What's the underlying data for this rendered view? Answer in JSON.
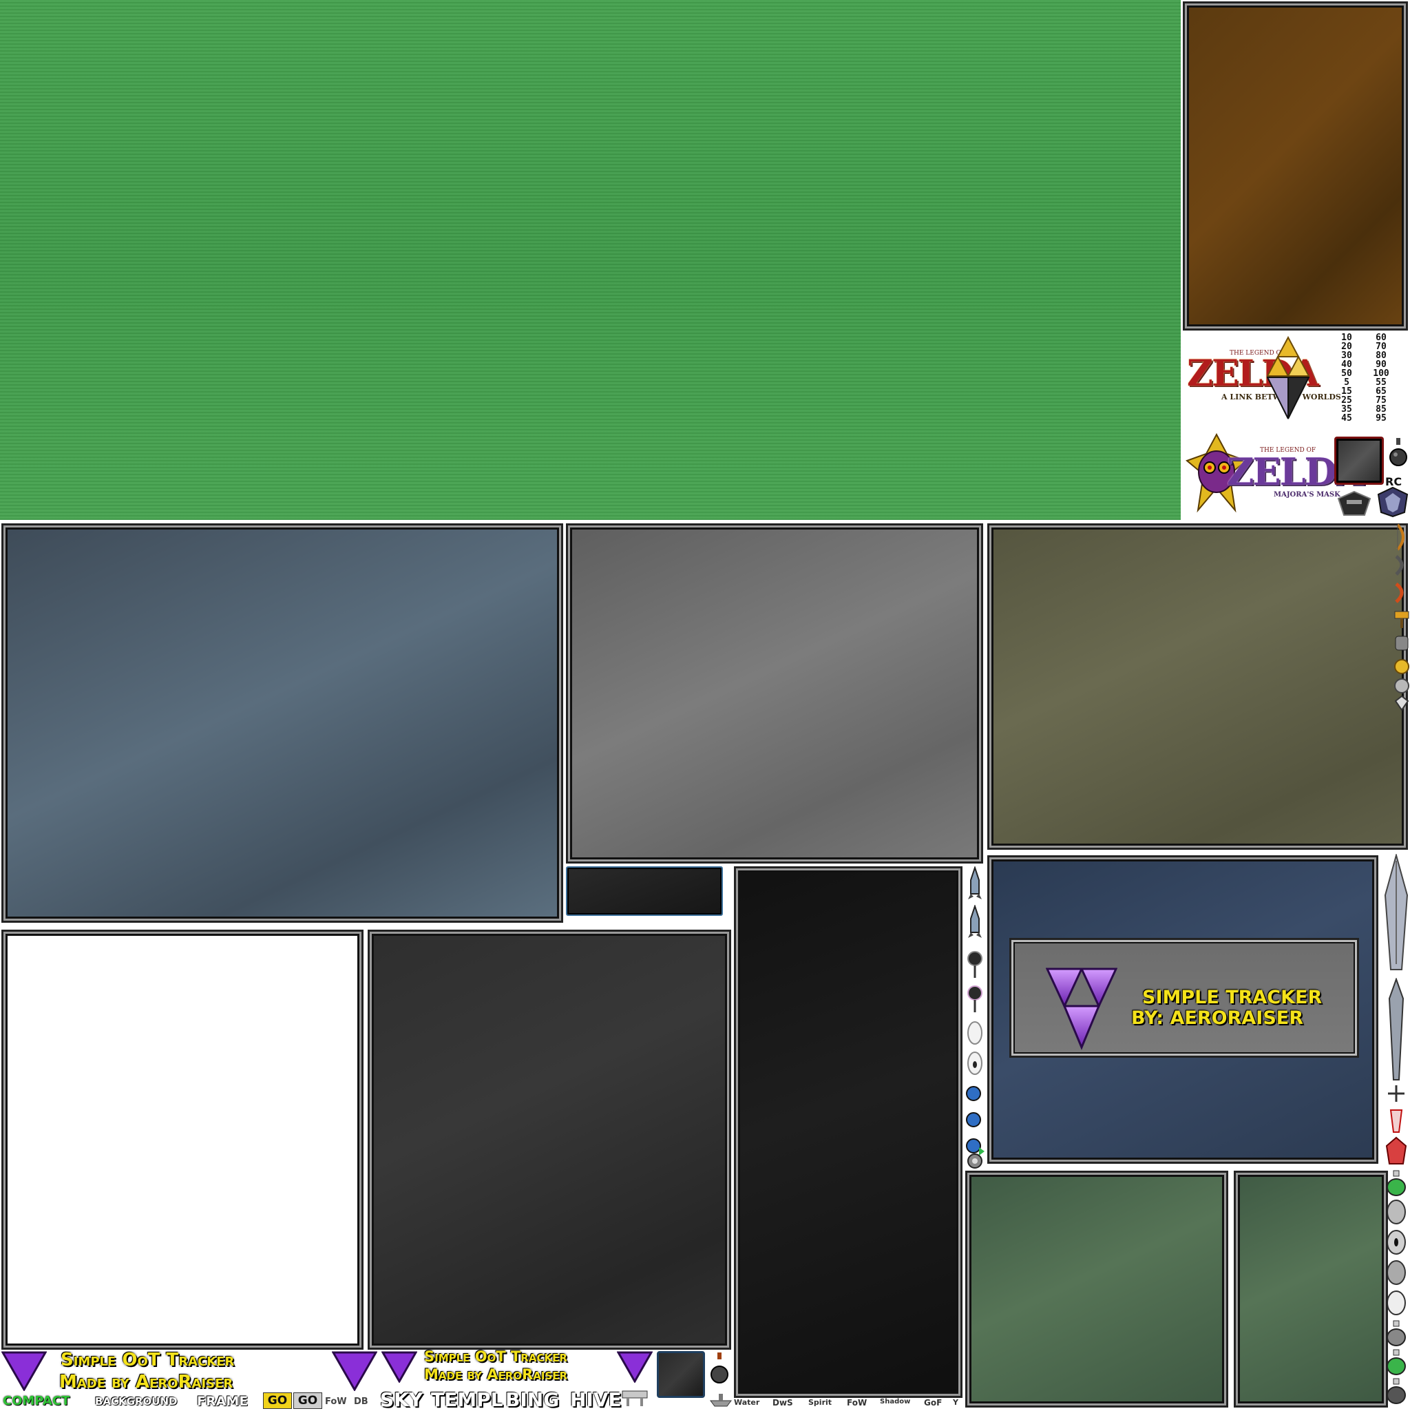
{
  "colors": {
    "green_bg": "#45a14e",
    "brown_bg": "#5b3a10",
    "bluegray_bg": "#4e5f6f",
    "gray_bg": "#707070",
    "olive_bg": "#5f5f48",
    "navy_bg": "#33445e",
    "tracker_yellow": "#f4e21a",
    "triforce_purple": "#9b3fe0"
  },
  "logos": {
    "albw": {
      "tagline": "THE LEGEND OF",
      "title": "ZELDA",
      "subtitle": "A LINK BETWEEN WORLDS"
    },
    "mm": {
      "tagline": "THE LEGEND OF",
      "title": "ZELDA",
      "subtitle": "MAJORA'S MASK"
    }
  },
  "number_grid": {
    "left": [
      "10",
      "20",
      "30",
      "40",
      "50",
      "5",
      "15",
      "25",
      "35",
      "45"
    ],
    "right": [
      "60",
      "70",
      "80",
      "90",
      "100",
      "55",
      "65",
      "75",
      "85",
      "95"
    ]
  },
  "rc_label": "RC",
  "banner": {
    "line1": "SIMPLE TRACKER",
    "line2": "BY: AERORAISER"
  },
  "bottom_strip": {
    "title_big_1": "Simple OoT Tracker",
    "title_big_2": "Made by AeroRaiser",
    "title_small_1": "Simple OoT Tracker",
    "title_small_2": "Made by AeroRaiser",
    "compact": "COMPACT",
    "background": "BACKGROUND",
    "frame": "FRAME",
    "chip_1": "GO",
    "chip_2": "GO",
    "fow": "FoW",
    "db": "DB",
    "sky": "SKY",
    "templ": "TEMPL",
    "bing": "BING",
    "hive": "HIVE",
    "dungeons": [
      "Water",
      "DwS",
      "Spirit",
      "FoW",
      "Shadow",
      "GoF",
      "Y"
    ]
  },
  "icons": [
    "triforce-icon",
    "bow-icon",
    "hookshot-icon",
    "bomb-icon",
    "arrow-icon",
    "sword-icon",
    "mask-icon",
    "potion-icon",
    "medallion-icon"
  ]
}
